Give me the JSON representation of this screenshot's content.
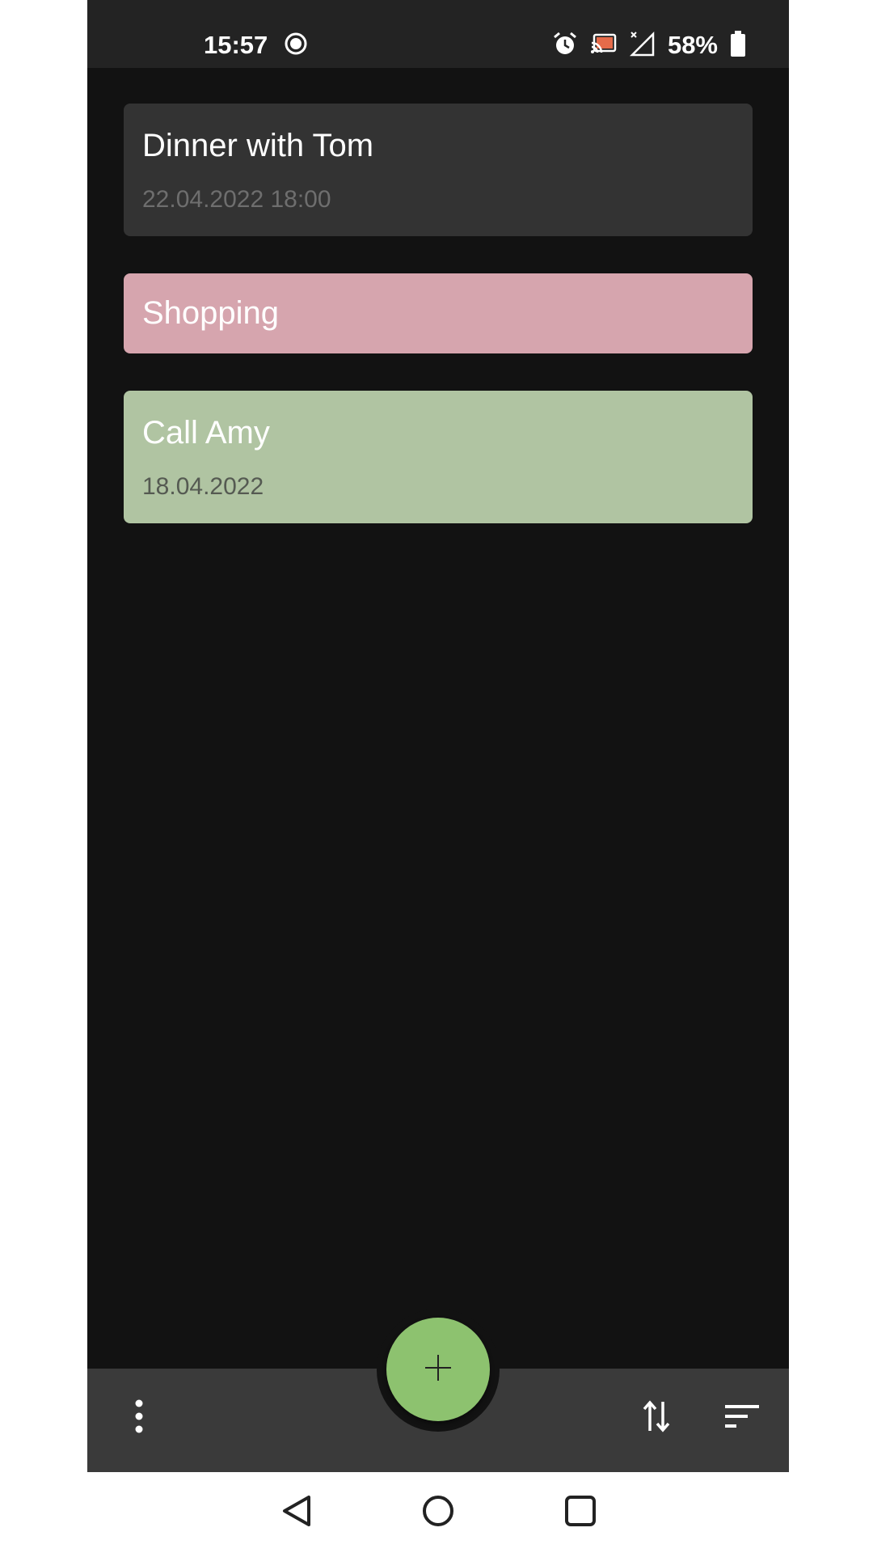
{
  "status_bar": {
    "time": "15:57",
    "battery_percent": "58%",
    "icons": [
      "record-icon",
      "alarm-icon",
      "cast-icon",
      "signal-icon",
      "battery-icon"
    ]
  },
  "tasks": [
    {
      "title": "Dinner with Tom",
      "date": "22.04.2022 18:00",
      "color": "#333333"
    },
    {
      "title": "Shopping",
      "date": "",
      "color": "#d6a5ae"
    },
    {
      "title": "Call Amy",
      "date": "18.04.2022",
      "color": "#b0c4a2"
    }
  ],
  "bottom_bar": {
    "icons": [
      "more-vert-icon",
      "sort-order-icon",
      "filter-list-icon"
    ],
    "fab_icon": "add-icon",
    "fab_color": "#8dc26f"
  },
  "nav_bar": {
    "icons": [
      "back-icon",
      "home-icon",
      "recents-icon"
    ]
  }
}
